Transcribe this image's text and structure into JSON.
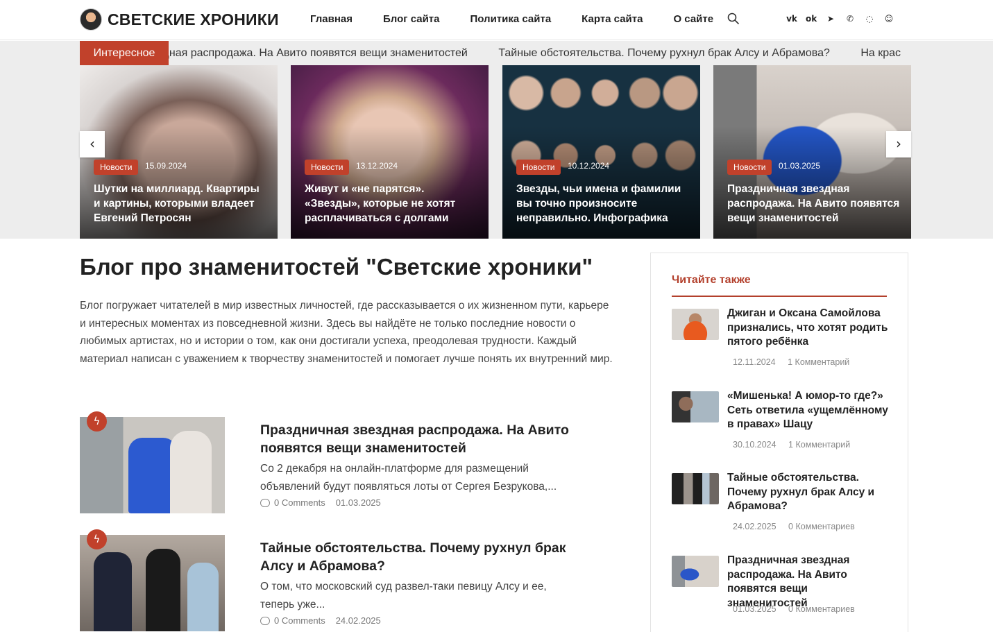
{
  "header": {
    "logo_text": "СВЕТСКИЕ ХРОНИКИ",
    "nav": [
      "Главная",
      "Блог сайта",
      "Политика сайта",
      "Карта сайта",
      "О сайте"
    ],
    "socials": [
      "vk-icon",
      "odnoklassniki-icon",
      "telegram-icon",
      "viber-icon",
      "whatsapp-icon",
      "vk-messenger-icon"
    ]
  },
  "ticker": {
    "label": "Интересное",
    "items": [
      "ездная распродажа. На Авито появятся вещи знаменитостей",
      "Тайные обстоятельства. Почему рухнул брак Алсу и Абрамова?",
      "На крас"
    ]
  },
  "slider": {
    "slides": [
      {
        "category": "Новости",
        "date": "15.09.2024",
        "title": "Шутки на миллиард. Квартиры и картины, которыми владеет Евгений Петросян"
      },
      {
        "category": "Новости",
        "date": "13.12.2024",
        "title": "Живут и «не парятся». «Звезды», которые не хотят расплачиваться с долгами"
      },
      {
        "category": "Новости",
        "date": "10.12.2024",
        "title": "Звезды, чьи имена и фамилии вы точно произносите неправильно. Инфографика"
      },
      {
        "category": "Новости",
        "date": "01.03.2025",
        "title": "Праздничная звездная распродажа. На Авито появятся вещи знаменитостей"
      }
    ],
    "prev": "‹",
    "next": "›"
  },
  "main": {
    "title": "Блог про знаменитостей \"Светские хроники\"",
    "intro": "Блог погружает читателей в мир известных личностей, где рассказывается о их жизненном пути, карьере и интересных моментах из повседневной жизни. Здесь вы найдёте не только последние новости о любимых артистах, но и истории о том, как они достигали успеха, преодолевая трудности. Каждый материал написан с уважением к творчеству знаменитостей и помогает лучше понять их внутренний мир.",
    "posts": [
      {
        "title": "Праздничная звездная распродажа. На Авито появятся вещи знаменитостей",
        "excerpt": "Со 2 декабря на онлайн-платформе для размещений объявлений будут появляться лоты от Сергея Безрукова,...",
        "comments": "0 Comments",
        "date": "01.03.2025"
      },
      {
        "title": "Тайные обстоятельства. Почему рухнул брак Алсу и Абрамова?",
        "excerpt": "О том, что московский суд развел-таки певицу Алсу и ее, теперь уже...",
        "comments": "0 Comments",
        "date": "24.02.2025"
      }
    ]
  },
  "sidebar": {
    "heading": "Читайте также",
    "items": [
      {
        "title": "Джиган и Оксана Самойлова признались, что хотят родить пятого ребёнка",
        "date": "12.11.2024",
        "comments": "1 Комментарий"
      },
      {
        "title": "«Мишенька! А юмор-то где?» Сеть ответила «ущемлённому в правах» Шацу",
        "date": "30.10.2024",
        "comments": "1 Комментарий"
      },
      {
        "title": "Тайные обстоятельства. Почему рухнул брак Алсу и Абрамова?",
        "date": "24.02.2025",
        "comments": "0 Комментариев"
      },
      {
        "title": "Праздничная звездная распродажа. На Авито появятся вещи знаменитостей",
        "date": "01.03.2025",
        "comments": "0 Комментариев"
      }
    ]
  },
  "colors": {
    "accent": "#c1412b",
    "band": "#ededed"
  }
}
